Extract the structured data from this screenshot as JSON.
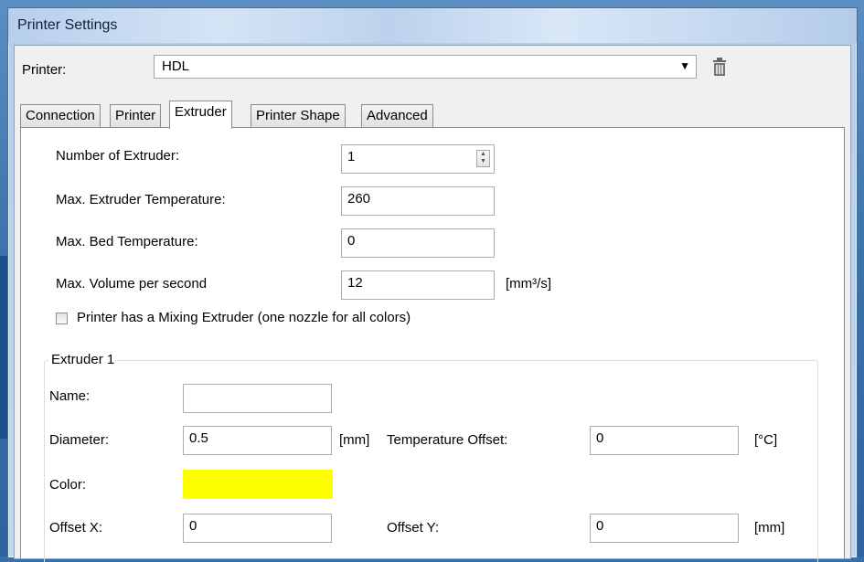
{
  "window": {
    "title": "Printer Settings"
  },
  "printer": {
    "label": "Printer:",
    "selected": "HDL",
    "delete_icon": "trash-icon"
  },
  "tabs": [
    {
      "label": "Connection",
      "active": false
    },
    {
      "label": "Printer",
      "active": false
    },
    {
      "label": "Extruder",
      "active": true
    },
    {
      "label": "Printer Shape",
      "active": false
    },
    {
      "label": "Advanced",
      "active": false
    }
  ],
  "extruder": {
    "num_label": "Number of Extruder:",
    "num_value": "1",
    "max_temp_label": "Max. Extruder Temperature:",
    "max_temp_value": "260",
    "bed_temp_label": "Max. Bed Temperature:",
    "bed_temp_value": "0",
    "volume_label": "Max. Volume per second",
    "volume_value": "12",
    "volume_unit": "[mm³/s]",
    "mixing_label": "Printer has a Mixing Extruder (one nozzle for all colors)",
    "mixing_checked": false
  },
  "extruder1": {
    "group_title": "Extruder 1",
    "name_label": "Name:",
    "name_value": "",
    "diameter_label": "Diameter:",
    "diameter_value": "0.5",
    "diameter_unit": "[mm]",
    "temp_offset_label": "Temperature Offset:",
    "temp_offset_value": "0",
    "temp_offset_unit": "[°C]",
    "color_label": "Color:",
    "color_value": "#ffff00",
    "offset_x_label": "Offset X:",
    "offset_x_value": "0",
    "offset_y_label": "Offset Y:",
    "offset_y_value": "0",
    "offset_unit": "[mm]"
  }
}
